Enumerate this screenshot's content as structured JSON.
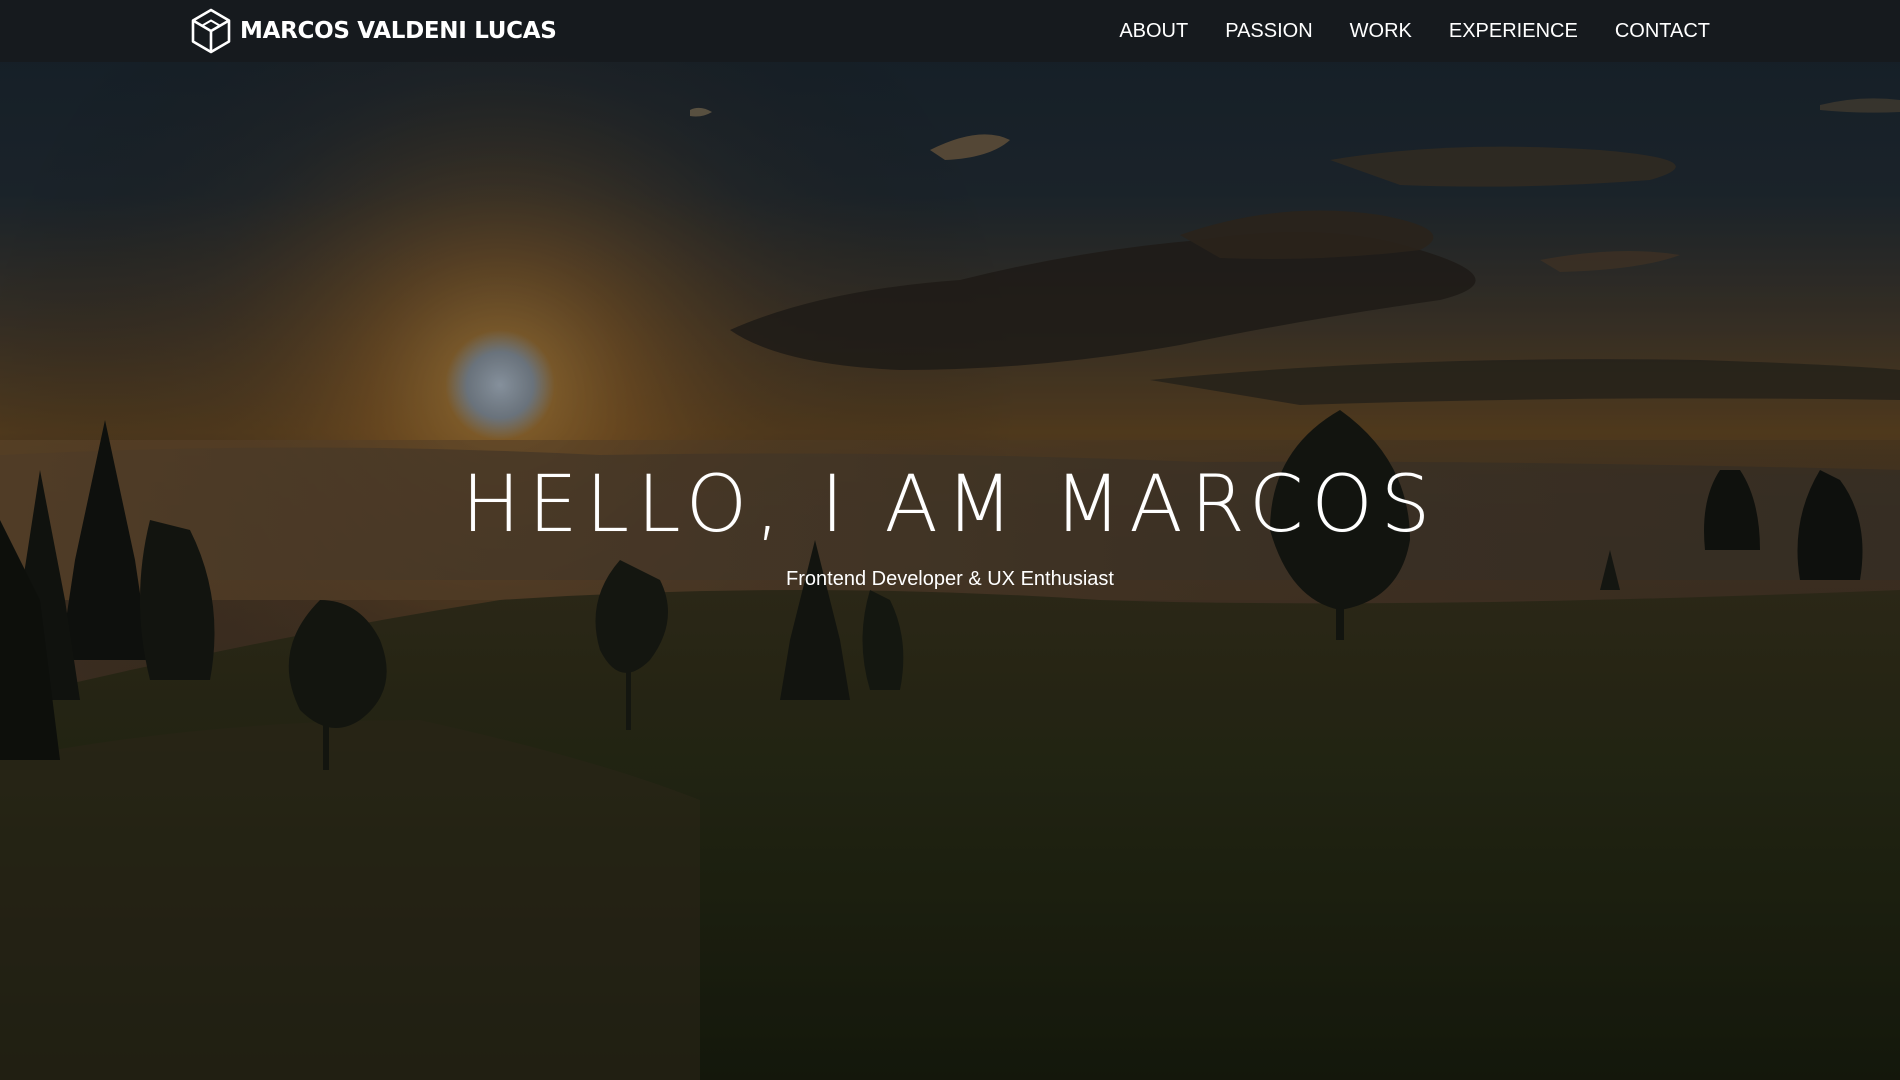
{
  "header": {
    "brand_name": "MARCOS VALDENI LUCAS",
    "logo_icon": "cube-icon"
  },
  "nav": {
    "items": [
      {
        "label": "ABOUT"
      },
      {
        "label": "PASSION"
      },
      {
        "label": "WORK"
      },
      {
        "label": "EXPERIENCE"
      },
      {
        "label": "CONTACT"
      }
    ]
  },
  "hero": {
    "title": "HELLO, I AM MARCOS",
    "subtitle": "Frontend Developer & UX Enthusiast",
    "background": "sunset-landscape-image"
  },
  "colors": {
    "navbar_bg": "#171a1e",
    "text": "#ffffff"
  }
}
